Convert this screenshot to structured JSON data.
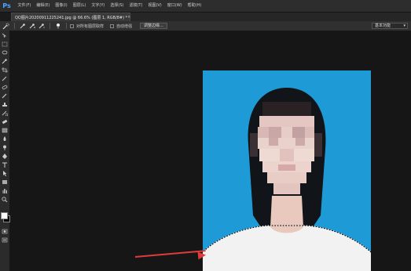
{
  "app": {
    "logo_text": "Ps"
  },
  "menu": {
    "items": [
      {
        "label": "文件(F)"
      },
      {
        "label": "编辑(E)"
      },
      {
        "label": "图像(I)"
      },
      {
        "label": "图层(L)"
      },
      {
        "label": "文字(Y)"
      },
      {
        "label": "选择(S)"
      },
      {
        "label": "滤镜(T)"
      },
      {
        "label": "视图(V)"
      },
      {
        "label": "窗口(W)"
      },
      {
        "label": "帮助(H)"
      }
    ]
  },
  "document_tab": {
    "title": "QQ图片20200911225241.jpg @ 66.6% (图层 1, RGB/8#) *",
    "close_glyph": "×"
  },
  "options_bar": {
    "sample_all_layers_label": "对所有图层取样",
    "auto_enhance_label": "自动增强",
    "refine_edge_label": "调整边缘...",
    "workspace_label": "基本功能"
  },
  "tools": [
    "move-tool-icon",
    "marquee-tool-icon",
    "lasso-tool-icon",
    "quick-selection-tool-icon",
    "crop-tool-icon",
    "eyedropper-tool-icon",
    "healing-brush-tool-icon",
    "brush-tool-icon",
    "clone-stamp-tool-icon",
    "history-brush-tool-icon",
    "eraser-tool-icon",
    "gradient-tool-icon",
    "blur-tool-icon",
    "dodge-tool-icon",
    "pen-tool-icon",
    "type-tool-icon",
    "path-selection-tool-icon",
    "shape-tool-icon",
    "hand-tool-icon",
    "zoom-tool-icon"
  ],
  "colors": {
    "foreground": "#ffffff",
    "background": "#000000",
    "photo_background": "#1e9bd7",
    "annotation_arrow": "#e23b3b"
  }
}
